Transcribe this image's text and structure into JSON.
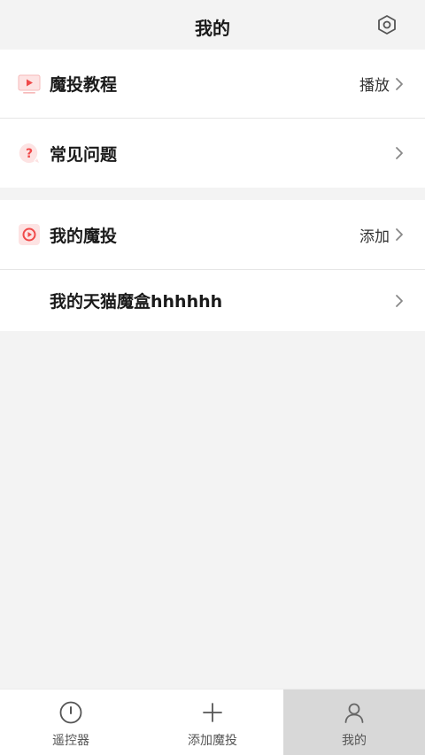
{
  "header": {
    "title": "我的",
    "settings_icon": "settings-hexagon-icon"
  },
  "sections": {
    "first": [
      {
        "label": "魔投教程",
        "action": "播放",
        "icon": "play-video-icon",
        "icon_color": "#f04a4a"
      },
      {
        "label": "常见问题",
        "action": "",
        "icon": "question-bubble-icon",
        "icon_color": "#f04a4a"
      }
    ],
    "second": [
      {
        "label": "我的魔投",
        "action": "添加",
        "icon": "cast-circle-icon",
        "icon_color": "#f04a4a"
      },
      {
        "label": "我的天猫魔盒hhhhhh",
        "action": ""
      }
    ]
  },
  "tabbar": {
    "items": [
      {
        "label": "遥控器",
        "icon": "remote-icon",
        "active": false
      },
      {
        "label": "添加魔投",
        "icon": "plus-icon",
        "active": false
      },
      {
        "label": "我的",
        "icon": "person-icon",
        "active": true
      }
    ]
  },
  "colors": {
    "accent": "#f04a4a",
    "background": "#f3f3f3",
    "active_tab": "#d8d8d8"
  }
}
